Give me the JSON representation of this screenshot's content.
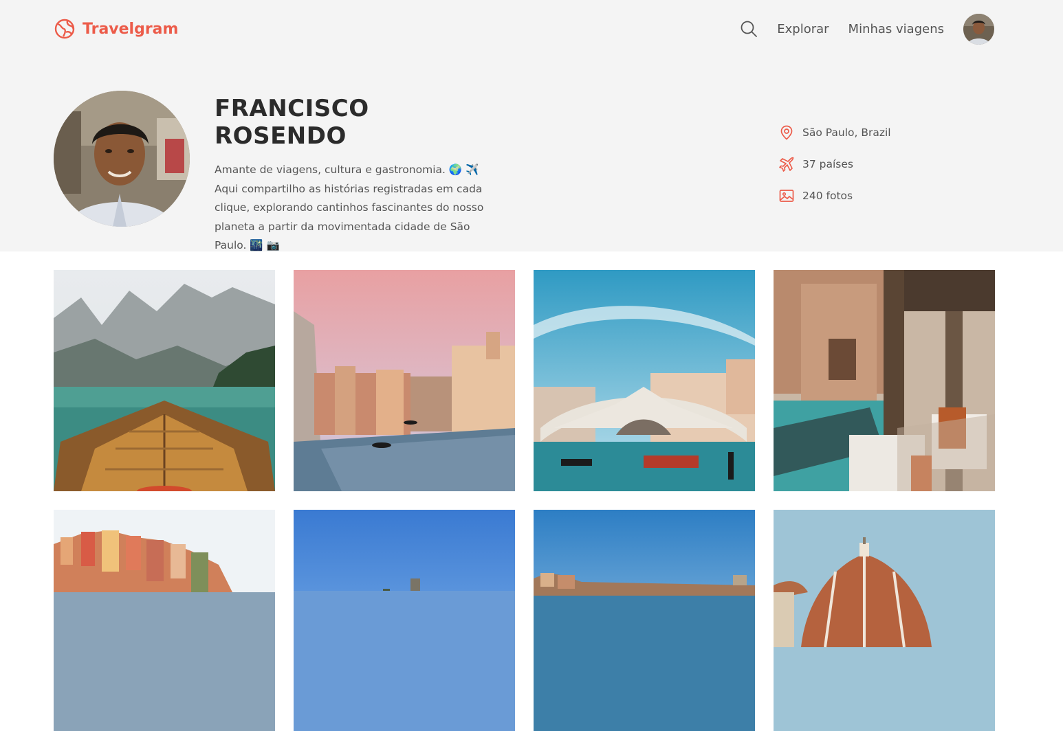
{
  "brand": {
    "name": "Travelgram",
    "color": "#ec5b49"
  },
  "nav": {
    "links": [
      "Explorar",
      "Minhas viagens"
    ],
    "icons": {
      "search": "search-icon",
      "logo": "globe-icon"
    }
  },
  "profile": {
    "name": "FRANCISCO ROSENDO",
    "bio": "Amante de viagens, cultura e gastronomia. 🌍 ✈️ Aqui compartilho as histórias registradas em cada clique, explorando cantinhos fascinantes do nosso planeta a partir da movimentada cidade de São Paulo. 🌃 📷"
  },
  "stats": {
    "location": "São Paulo, Brazil",
    "countries": "37 países",
    "photos": "240 fotos",
    "icons": [
      "location-pin-icon",
      "plane-icon",
      "image-icon"
    ]
  },
  "gallery": {
    "photos": [
      "lake-boat",
      "venice-canal",
      "rialto-bridge",
      "venice-restaurant",
      "cinque-terre",
      "blue-sky-tower",
      "harbor-town",
      "florence-dome"
    ]
  }
}
